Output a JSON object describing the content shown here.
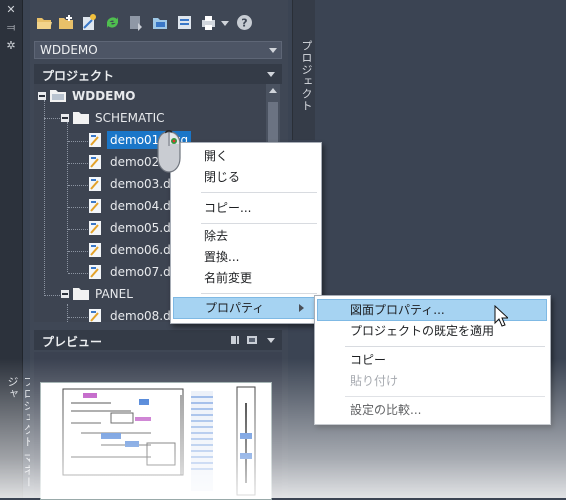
{
  "left_strip": {
    "title": "プロジェクト マネージャ",
    "buttons": [
      "close-icon",
      "auto-hide-icon",
      "properties-icon"
    ]
  },
  "toolbar": {
    "icons": [
      "open-project-icon",
      "new-project-icon",
      "new-drawing-icon",
      "refresh-icon",
      "update-icon",
      "project-task-list-icon",
      "project-settings-icon",
      "plot-icon",
      "dropdown-icon",
      "help-icon"
    ]
  },
  "project_combo": {
    "value": "WDDEMO"
  },
  "project_section": {
    "title": "プロジェクト"
  },
  "side_tab": {
    "label": "プロジェクト"
  },
  "tree": {
    "root": "WDDEMO",
    "folders": [
      {
        "name": "SCHEMATIC",
        "files": [
          "demo01.dwg",
          "demo02.dwg",
          "demo03.dwg",
          "demo04.dwg",
          "demo05.dwg",
          "demo06.dwg",
          "demo07.dwg"
        ]
      },
      {
        "name": "PANEL",
        "files": [
          "demo08.dwg"
        ]
      }
    ],
    "visible_labels": [
      "demo01.dwg",
      "demo02",
      "demo03.d",
      "demo04.d",
      "demo05.d",
      "demo06.d",
      "demo07.d",
      "demo08.d"
    ]
  },
  "preview_section": {
    "title": "プレビュー"
  },
  "context_menu": {
    "items": [
      "開く",
      "閉じる",
      "コピー...",
      "除去",
      "置換...",
      "名前変更",
      "プロパティ"
    ],
    "highlighted": "プロパティ"
  },
  "submenu": {
    "items": [
      "図面プロパティ...",
      "プロジェクトの既定を適用",
      "コピー",
      "貼り付け",
      "設定の比較..."
    ],
    "highlighted": "図面プロパティ...",
    "disabled": [
      "貼り付け"
    ]
  },
  "colors": {
    "selection": "#1a76c8",
    "menu_highlight": "#a6d3f2",
    "panel_bg": "#3f4755"
  }
}
